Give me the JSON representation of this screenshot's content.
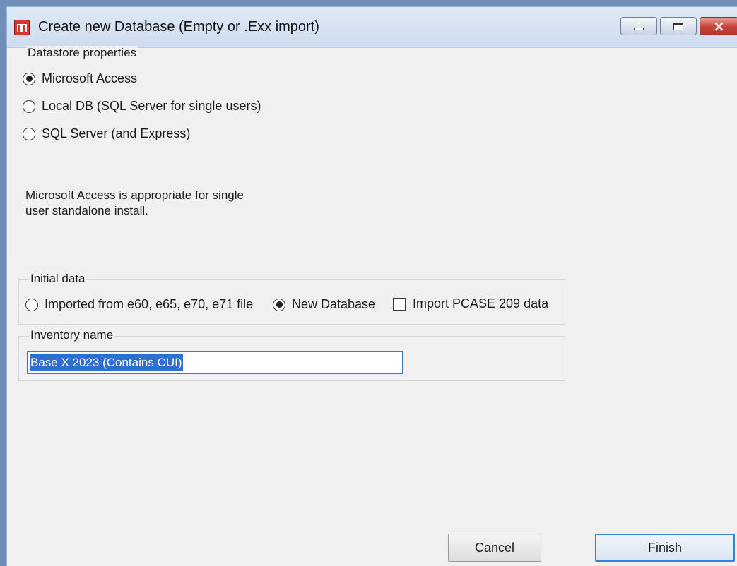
{
  "window": {
    "title": "Create new Database (Empty or .Exx import)",
    "icon": "app-icon",
    "controls": {
      "minimize": "minimize-icon",
      "maximize": "maximize-icon",
      "close": "×"
    }
  },
  "datastore": {
    "legend": "Datastore properties",
    "options": [
      {
        "label": "Microsoft Access",
        "selected": true
      },
      {
        "label": "Local DB (SQL Server for single users)",
        "selected": false
      },
      {
        "label": "SQL Server (and Express)",
        "selected": false
      }
    ],
    "description_line1": "Microsoft Access is appropriate for single",
    "description_line2": "user standalone install."
  },
  "initial_data": {
    "legend": "Initial data",
    "imported_label": "Imported from e60, e65, e70, e71 file",
    "imported_selected": false,
    "new_db_label": "New Database",
    "new_db_selected": true,
    "pcase_label": "Import PCASE 209 data",
    "pcase_checked": false
  },
  "inventory": {
    "legend": "Inventory name",
    "value": "Base X 2023 (Contains  CUI)"
  },
  "buttons": {
    "cancel": "Cancel",
    "finish": "Finish"
  },
  "colors": {
    "accent": "#3c7fd6",
    "selection": "#2f6fd0",
    "close_button": "#c8443a"
  }
}
